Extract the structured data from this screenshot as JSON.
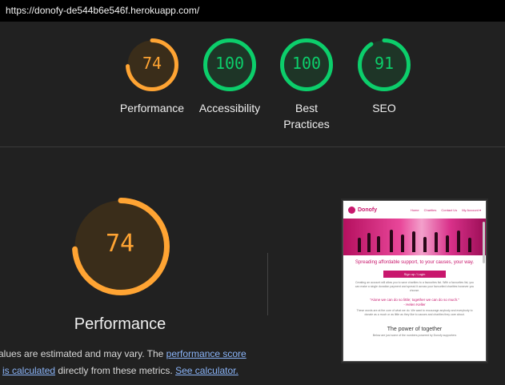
{
  "url": "https://donofy-de544b6e546f.herokuapp.com/",
  "colors": {
    "average": "#ffa433",
    "pass": "#0cce6b",
    "average_bg": "#3a2d1a",
    "pass_bg": "#1e3527"
  },
  "gauges": [
    {
      "label": "Performance",
      "score": "74",
      "fraction": 0.74,
      "status": "average"
    },
    {
      "label": "Accessibility",
      "score": "100",
      "fraction": 1.0,
      "status": "pass"
    },
    {
      "label": "Best Practices",
      "label_line1": "Best",
      "label_line2": "Practices",
      "score": "100",
      "fraction": 1.0,
      "status": "pass"
    },
    {
      "label": "SEO",
      "score": "91",
      "fraction": 0.91,
      "status": "pass"
    }
  ],
  "main": {
    "score": "74",
    "fraction": 0.74,
    "title": "Performance",
    "note_prefix": "alues are estimated and may vary. The ",
    "link_score": "performance score",
    "link_calc_text": "is calculated",
    "note_mid": " directly from these metrics. ",
    "link_calculator": "See calculator."
  },
  "screenshot": {
    "brand": "Donofy",
    "nav": [
      "Home",
      "Charities",
      "Contact Us",
      "My Account ▾"
    ],
    "tagline": "Spreading affordable support, to your causes, your way.",
    "cta": "Sign up / Login",
    "body": "Creating an account will allow you to save charities to a favourites list. With a favourites list, you can make a single donation payment and spread it across your favourited charities however you choose.",
    "quote": "\"Alone we can do so little; together we can do so much.\"",
    "quote_author": "- Helen Keller",
    "body2": "These words are at the core of what we do. We want to encourage anybody and everybody to donate as a much or as little as they like to causes and charities they care about.",
    "heading": "The power of together",
    "footer_line": "Below are just some of the numbers powered by Donofy supporters"
  }
}
